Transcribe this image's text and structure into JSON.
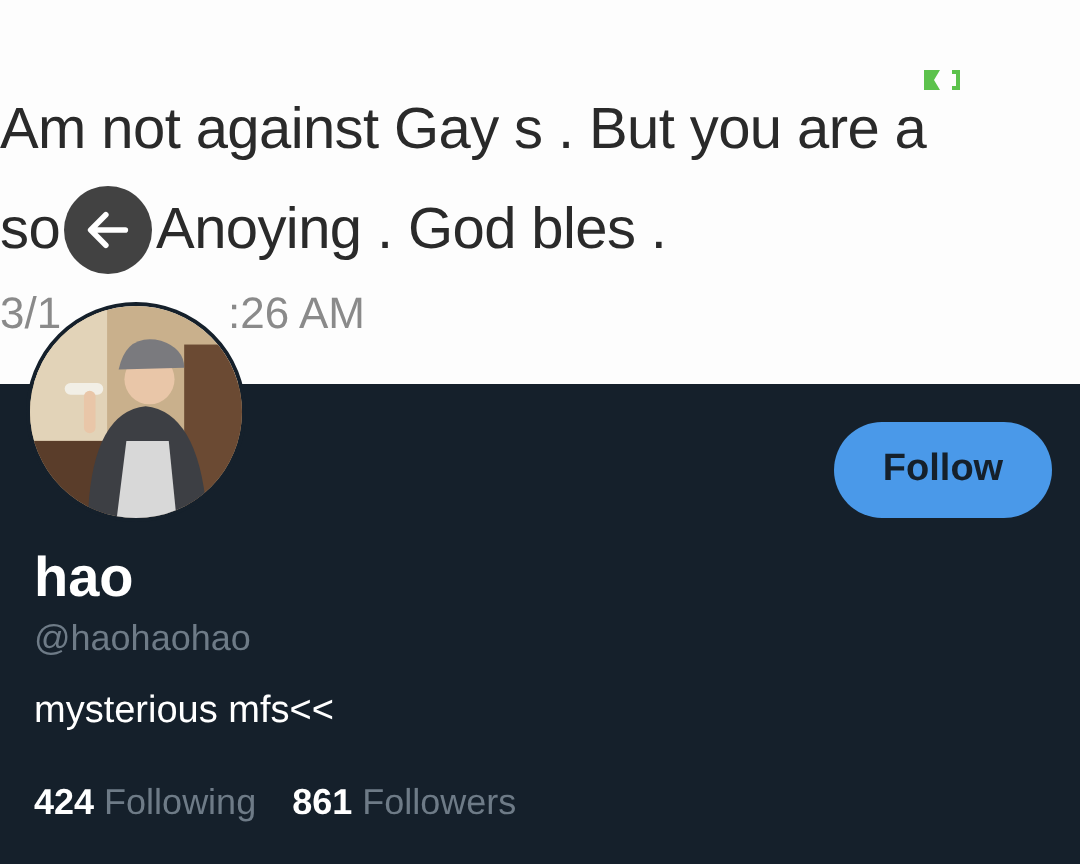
{
  "header_image": {
    "line_1": "Am not against Gay s . But you are a",
    "line_2_parts": [
      "so",
      "Anoying . God bles ."
    ],
    "timestamp_parts": [
      "3/1",
      ":26 AM"
    ]
  },
  "profile": {
    "name": "hao",
    "handle": "@haohaohao",
    "bio": "mysterious mfs<<",
    "follow_button": {
      "label": "Follow",
      "following": false
    },
    "stats": [
      {
        "count": "424",
        "label": "Following"
      },
      {
        "count": "861",
        "label": "Followers"
      }
    ]
  }
}
